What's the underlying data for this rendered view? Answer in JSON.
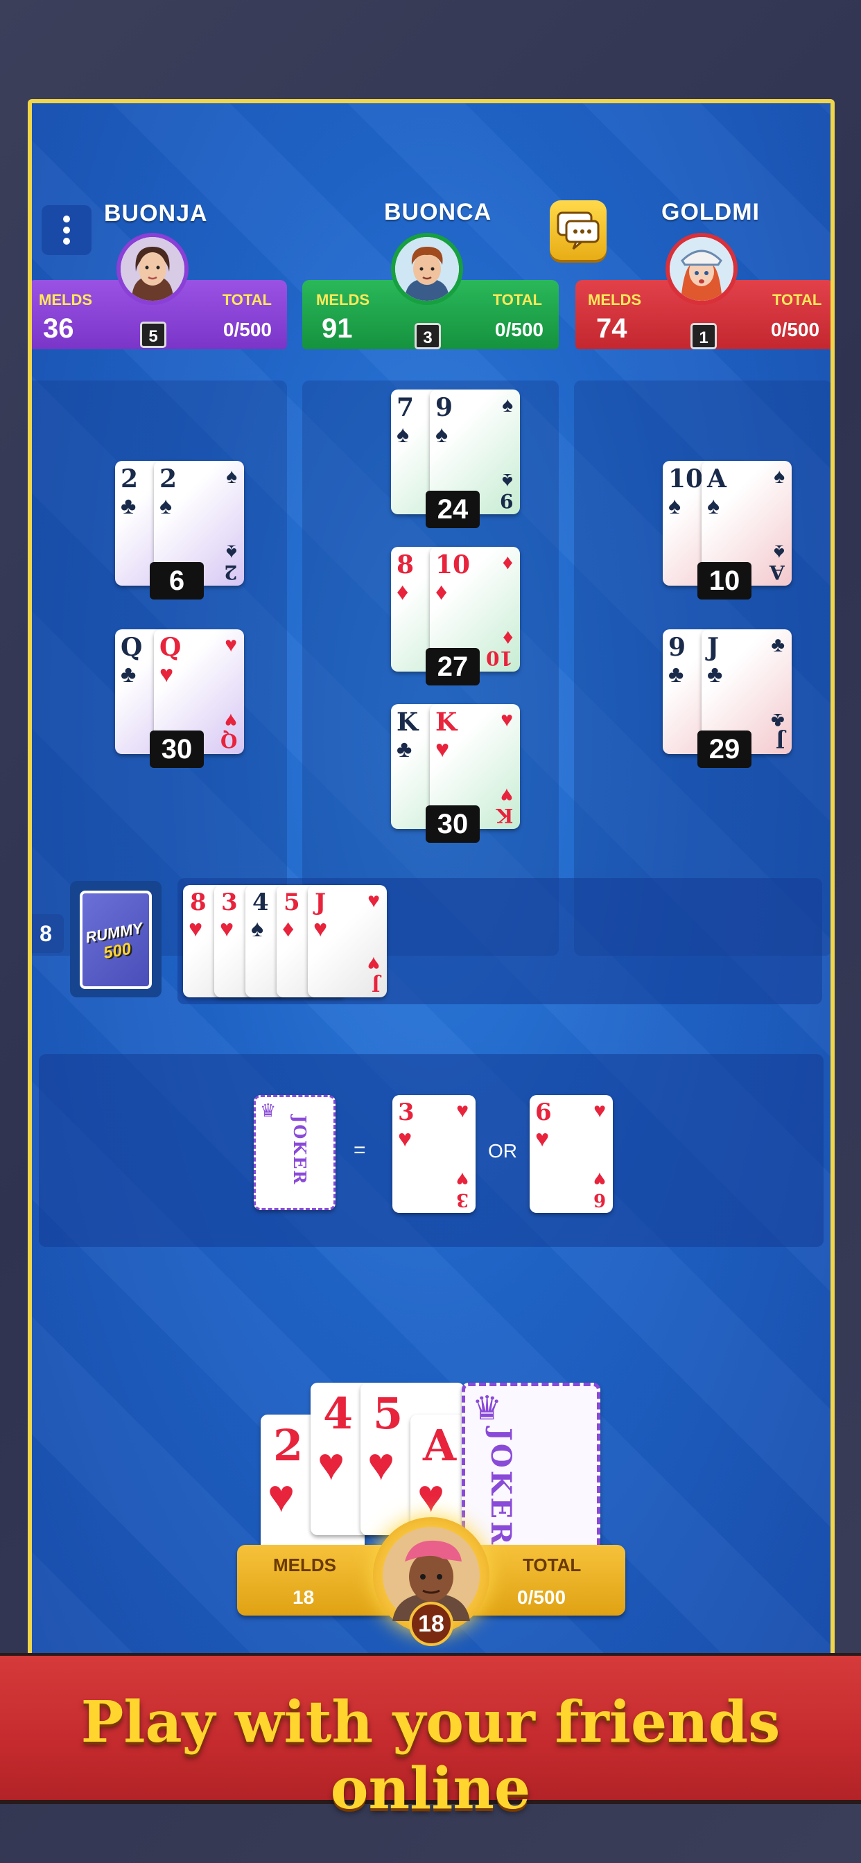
{
  "players": {
    "left": {
      "name": "BUONJA",
      "melds_label": "MELDS",
      "total_label": "TOTAL",
      "melds": "36",
      "cards": "5",
      "total": "0/500",
      "color": "#8a3fd6"
    },
    "center": {
      "name": "BUONCA",
      "melds_label": "MELDS",
      "total_label": "TOTAL",
      "melds": "91",
      "cards": "3",
      "total": "0/500",
      "color": "#1fa64a"
    },
    "right": {
      "name": "GOLDMI",
      "melds_label": "MELDS",
      "total_label": "TOTAL",
      "melds": "74",
      "cards": "1",
      "total": "0/500",
      "color": "#d9303a"
    }
  },
  "melds": {
    "left": [
      {
        "cards": [
          [
            "2",
            "♣"
          ],
          [
            "2",
            "♠"
          ]
        ],
        "score": "6"
      },
      {
        "cards": [
          [
            "Q",
            "♣"
          ],
          [
            "Q",
            "♥"
          ]
        ],
        "score": "30"
      }
    ],
    "center": [
      {
        "cards": [
          [
            "7",
            "♠"
          ],
          [
            "9",
            "♠"
          ]
        ],
        "score": "24"
      },
      {
        "cards": [
          [
            "8",
            "♦"
          ],
          [
            "10",
            "♦"
          ]
        ],
        "score": "27"
      },
      {
        "cards": [
          [
            "K",
            "♣"
          ],
          [
            "K",
            "♥"
          ]
        ],
        "score": "30"
      }
    ],
    "right": [
      {
        "cards": [
          [
            "10",
            "♠"
          ],
          [
            "A",
            "♠"
          ]
        ],
        "score": "10"
      },
      {
        "cards": [
          [
            "9",
            "♣"
          ],
          [
            "J",
            "♣"
          ]
        ],
        "score": "29"
      }
    ]
  },
  "deck": {
    "count": "8",
    "logo_line1": "RUMMY",
    "logo_line2": "500"
  },
  "discard": [
    [
      "8",
      "♥"
    ],
    [
      "3",
      "♥"
    ],
    [
      "4",
      "♠"
    ],
    [
      "5",
      "♦"
    ],
    [
      "J",
      "♥"
    ]
  ],
  "hint": {
    "joker_text": "JOKER",
    "equals": "=",
    "or": "OR",
    "option1": [
      "3",
      "♥"
    ],
    "option2": [
      "6",
      "♥"
    ]
  },
  "hand": {
    "cards": [
      [
        "2",
        "♥"
      ],
      [
        "4",
        "♥"
      ],
      [
        "5",
        "♥"
      ],
      [
        "A",
        "♥"
      ]
    ],
    "joker_text": "JOKER"
  },
  "me": {
    "melds_label": "MELDS",
    "melds": "18",
    "total_label": "TOTAL",
    "total": "0/500",
    "cards": "18"
  },
  "banner": {
    "text": "Play with your friends online"
  },
  "icons": {
    "menu": "menu-dots-icon",
    "chat": "chat-icon"
  }
}
